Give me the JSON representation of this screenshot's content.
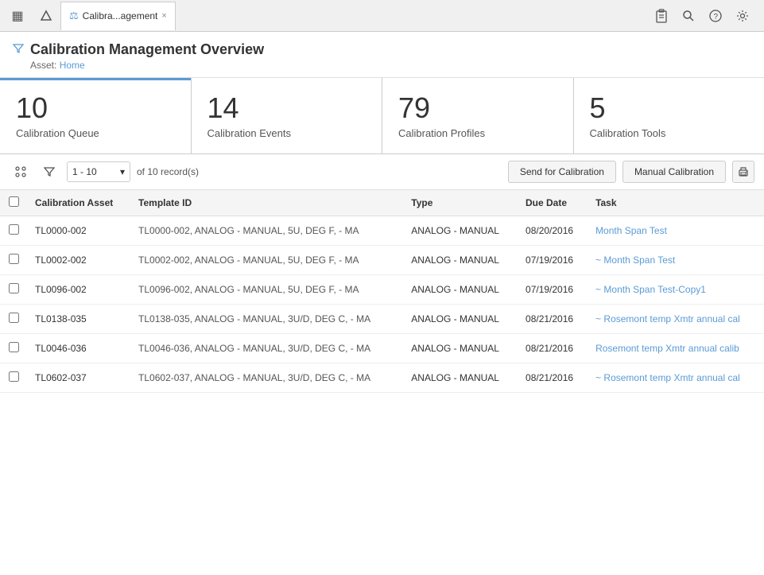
{
  "tabs": {
    "icons": [
      {
        "name": "dashboard-icon",
        "symbol": "▦"
      },
      {
        "name": "tree-icon",
        "symbol": "▲"
      }
    ],
    "active": {
      "icon": "⚖",
      "label": "Calibra...agement",
      "close": "×"
    }
  },
  "top_icons": [
    {
      "name": "clipboard-icon",
      "symbol": "📋"
    },
    {
      "name": "search-icon",
      "symbol": "🔍"
    },
    {
      "name": "help-icon",
      "symbol": "?"
    },
    {
      "name": "settings-icon",
      "symbol": "⚙"
    }
  ],
  "header": {
    "filter_icon": "▽",
    "title": "Calibration Management Overview",
    "breadcrumb_label": "Asset:",
    "breadcrumb_link": "Home"
  },
  "stats": [
    {
      "number": "10",
      "label": "Calibration Queue",
      "active": true
    },
    {
      "number": "14",
      "label": "Calibration Events",
      "active": false
    },
    {
      "number": "79",
      "label": "Calibration Profiles",
      "active": false
    },
    {
      "number": "5",
      "label": "Calibration Tools",
      "active": false
    }
  ],
  "toolbar": {
    "tools_icon": "⚙",
    "filter_icon": "▽",
    "pager": "1 - 10",
    "pager_chevron": "▾",
    "record_count": "of 10 record(s)",
    "btn_send": "Send for Calibration",
    "btn_manual": "Manual Calibration",
    "btn_print": "🖨"
  },
  "table": {
    "columns": [
      "",
      "Calibration Asset",
      "Template ID",
      "Type",
      "Due Date",
      "Task"
    ],
    "rows": [
      {
        "asset": "TL0000-002",
        "template": "TL0000-002, ANALOG - MANUAL, 5U, DEG F, - MA",
        "type": "ANALOG - MANUAL",
        "due_date": "08/20/2016",
        "task": "Month Span Test",
        "task_prefix": ""
      },
      {
        "asset": "TL0002-002",
        "template": "TL0002-002, ANALOG - MANUAL, 5U, DEG F, - MA",
        "type": "ANALOG - MANUAL",
        "due_date": "07/19/2016",
        "task": "~ Month Span Test",
        "task_prefix": "~"
      },
      {
        "asset": "TL0096-002",
        "template": "TL0096-002, ANALOG - MANUAL, 5U, DEG F, - MA",
        "type": "ANALOG - MANUAL",
        "due_date": "07/19/2016",
        "task": "~ Month Span Test-Copy1",
        "task_prefix": "~"
      },
      {
        "asset": "TL0138-035",
        "template": "TL0138-035, ANALOG - MANUAL, 3U/D, DEG C, - MA",
        "type": "ANALOG - MANUAL",
        "due_date": "08/21/2016",
        "task": "~ Rosemont temp Xmtr annual cal",
        "task_prefix": "~"
      },
      {
        "asset": "TL0046-036",
        "template": "TL0046-036, ANALOG - MANUAL, 3U/D, DEG C, - MA",
        "type": "ANALOG - MANUAL",
        "due_date": "08/21/2016",
        "task": "Rosemont temp Xmtr annual calib",
        "task_prefix": ""
      },
      {
        "asset": "TL0602-037",
        "template": "TL0602-037, ANALOG - MANUAL, 3U/D, DEG C, - MA",
        "type": "ANALOG - MANUAL",
        "due_date": "08/21/2016",
        "task": "~ Rosemont temp Xmtr annual cal",
        "task_prefix": "~"
      }
    ]
  }
}
